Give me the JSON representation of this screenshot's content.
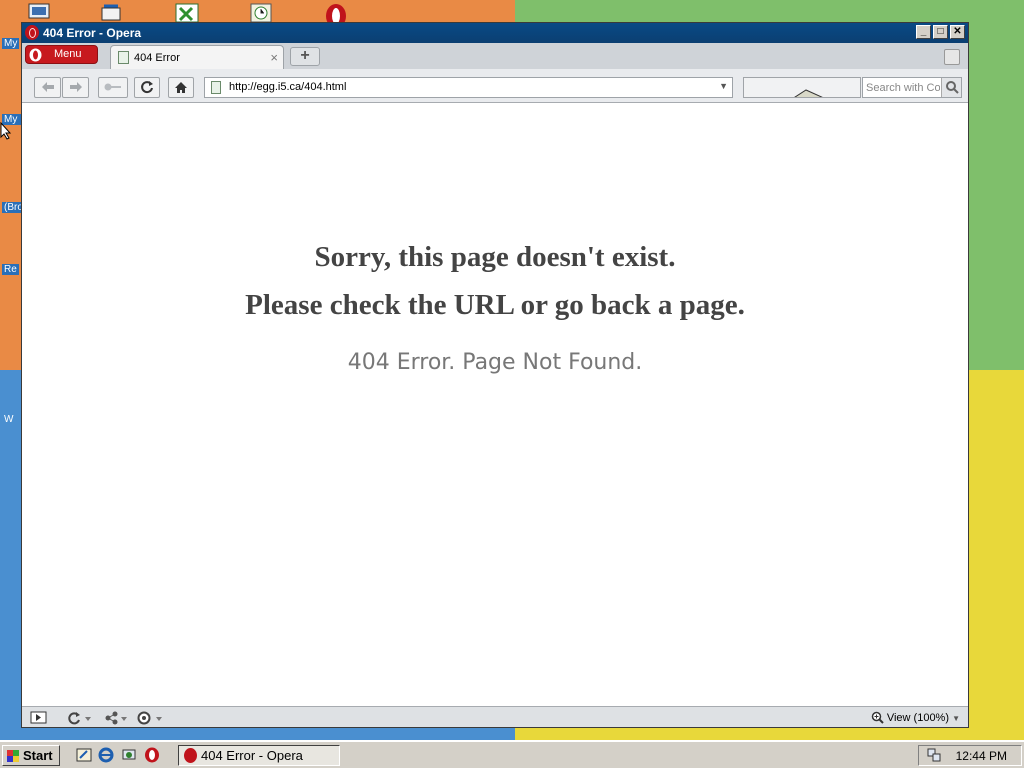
{
  "desktop": {
    "labels": [
      "My",
      "My I",
      "(Bro",
      "Re",
      "W"
    ]
  },
  "window": {
    "title": "404 Error - Opera",
    "menu_label": "Menu",
    "tab_label": "404 Error",
    "tab_close": "×",
    "new_tab": "+",
    "url": "http://egg.i5.ca/404.html",
    "search_placeholder": "Search with Co",
    "zoom_label": "View (100%)"
  },
  "page": {
    "line1": "Sorry, this page doesn't exist.",
    "line2": "Please check the URL or go back a page.",
    "subtitle": "404 Error. Page Not Found."
  },
  "taskbar": {
    "start_label": "Start",
    "task_label": "404 Error - Opera",
    "clock": "12:44 PM"
  },
  "colors": {
    "title_bar": "#0b4a86",
    "opera_red": "#c7191e",
    "heading_text": "#444444",
    "subtitle_text": "#777777"
  },
  "icons": [
    "opera-logo-icon",
    "back-arrow-icon",
    "forward-arrow-icon",
    "key-icon",
    "reload-icon",
    "home-icon",
    "page-icon",
    "search-icon",
    "trash-icon",
    "sidebar-toggle-icon",
    "sync-icon",
    "unite-icon",
    "turbo-icon",
    "zoom-icon"
  ]
}
